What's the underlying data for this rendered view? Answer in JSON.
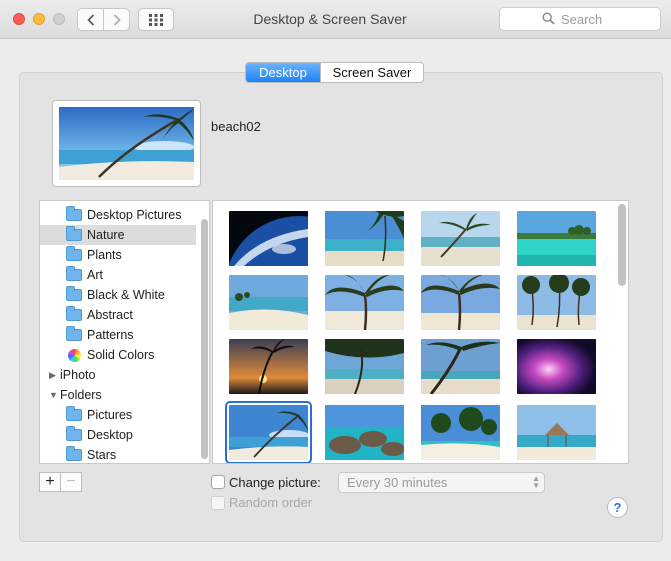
{
  "window": {
    "title": "Desktop & Screen Saver",
    "search_placeholder": "Search"
  },
  "tabs": {
    "desktop": "Desktop",
    "screen_saver": "Screen Saver",
    "active": "Desktop"
  },
  "current_picture": {
    "name": "beach02"
  },
  "sidebar": {
    "items": [
      {
        "label": "Desktop Pictures",
        "icon": "folder-icon",
        "indent": 1,
        "selected": false
      },
      {
        "label": "Nature",
        "icon": "folder-icon",
        "indent": 1,
        "selected": true
      },
      {
        "label": "Plants",
        "icon": "folder-icon",
        "indent": 1,
        "selected": false
      },
      {
        "label": "Art",
        "icon": "folder-icon",
        "indent": 1,
        "selected": false
      },
      {
        "label": "Black & White",
        "icon": "folder-icon",
        "indent": 1,
        "selected": false
      },
      {
        "label": "Abstract",
        "icon": "folder-icon",
        "indent": 1,
        "selected": false
      },
      {
        "label": "Patterns",
        "icon": "folder-icon",
        "indent": 1,
        "selected": false
      },
      {
        "label": "Solid Colors",
        "icon": "color-wheel-icon",
        "indent": 1,
        "selected": false
      },
      {
        "label": "iPhoto",
        "icon": "disclosure-right-icon",
        "indent": 0,
        "selected": false
      },
      {
        "label": "Folders",
        "icon": "disclosure-down-icon",
        "indent": 0,
        "selected": false
      },
      {
        "label": "Pictures",
        "icon": "folder-icon",
        "indent": 1,
        "selected": false
      },
      {
        "label": "Desktop",
        "icon": "folder-icon",
        "indent": 1,
        "selected": false
      },
      {
        "label": "Stars",
        "icon": "folder-icon",
        "indent": 1,
        "selected": false
      }
    ]
  },
  "wallpapers": [
    {
      "theme": "earth-from-space",
      "selected": false
    },
    {
      "theme": "tropical-shore",
      "selected": false
    },
    {
      "theme": "leaning-palm-beach",
      "selected": false
    },
    {
      "theme": "turquoise-lagoon",
      "selected": false
    },
    {
      "theme": "beach-shoreline",
      "selected": false
    },
    {
      "theme": "palm-fronds-beach",
      "selected": false
    },
    {
      "theme": "palm-fronds-beach-2",
      "selected": false
    },
    {
      "theme": "palm-grove",
      "selected": false
    },
    {
      "theme": "palm-sunset",
      "selected": false
    },
    {
      "theme": "palm-shade-beach",
      "selected": false
    },
    {
      "theme": "palm-trunk-beach",
      "selected": false
    },
    {
      "theme": "purple-aurora",
      "selected": false
    },
    {
      "theme": "beach02",
      "selected": true
    },
    {
      "theme": "rocky-coast",
      "selected": false
    },
    {
      "theme": "palm-island",
      "selected": false
    },
    {
      "theme": "beach-hut",
      "selected": false
    }
  ],
  "controls": {
    "add_label": "+",
    "remove_label": "−",
    "change_picture_label": "Change picture:",
    "change_picture_checked": false,
    "interval": "Every 30 minutes",
    "random_order_label": "Random order",
    "random_order_enabled": false,
    "help_label": "?"
  }
}
